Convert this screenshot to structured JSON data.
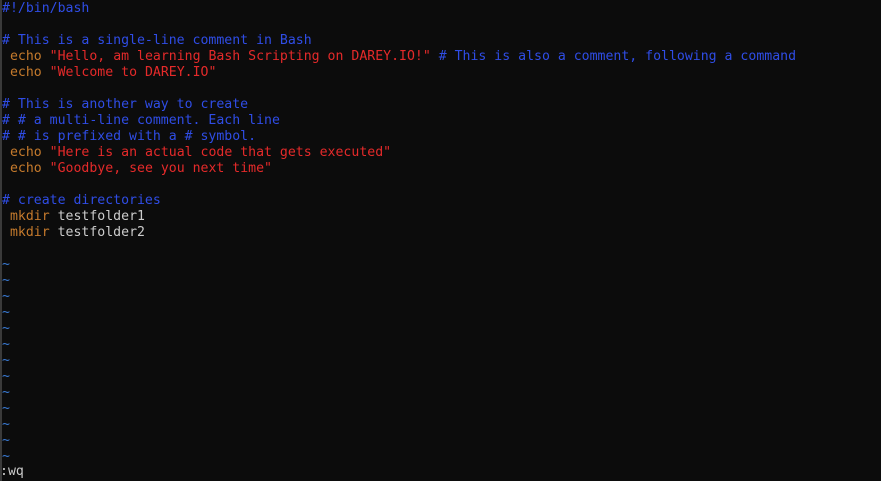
{
  "editor": {
    "shebang": "#!/bin/bash",
    "lines": {
      "l3_comment": "# This is a single-line comment in Bash",
      "l4_cmd": "echo",
      "l4_string": "\"Hello, am learning Bash Scripting on DAREY.IO!\"",
      "l4_comment": "# This is also a comment, following a command",
      "l5_cmd": "echo",
      "l5_string": "\"Welcome to DAREY.IO\"",
      "l7_comment": "# This is another way to create",
      "l8_comment": "# # a multi-line comment. Each line",
      "l9_comment": "# # is prefixed with a # symbol.",
      "l10_cmd": "echo",
      "l10_string": "\"Here is an actual code that gets executed\"",
      "l11_cmd": "echo",
      "l11_string": "\"Goodbye, see you next time\"",
      "l13_comment": "# create directories",
      "l14_cmd": "mkdir",
      "l14_arg": "testfolder1",
      "l15_cmd": "mkdir",
      "l15_arg": "testfolder2"
    },
    "empty_line_marker": "~"
  },
  "command_line": {
    "value": ":wq"
  },
  "colors": {
    "background": "#0c0c0c",
    "comment": "#2f4de6",
    "keyword": "#c57a2c",
    "string": "#e52a2a",
    "text": "#cccccc",
    "tilde": "#3a7bd5"
  }
}
